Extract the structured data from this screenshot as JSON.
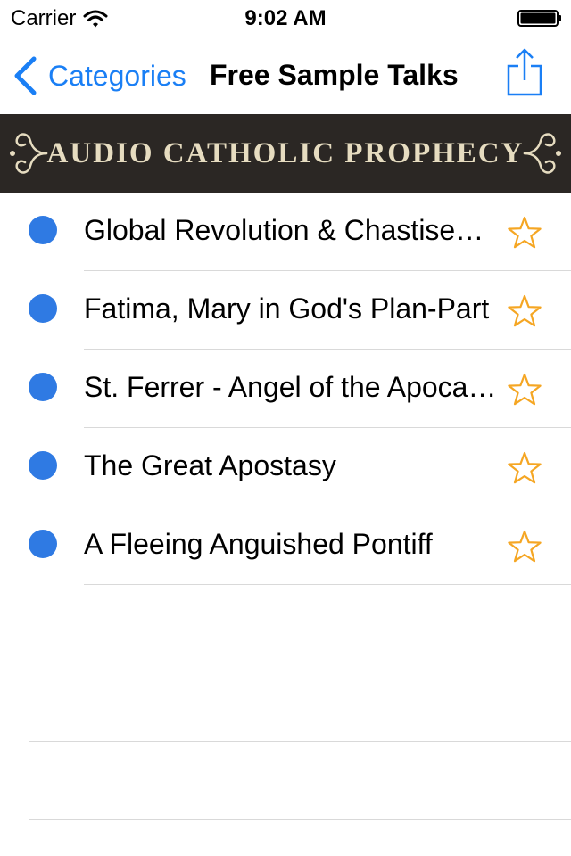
{
  "status_bar": {
    "carrier": "Carrier",
    "time": "9:02 AM"
  },
  "nav": {
    "back_label": "Categories",
    "title": "Free Sample Talks"
  },
  "banner": {
    "text": "Audio Catholic Prophecy"
  },
  "talks": [
    {
      "title": "Global Revolution & Chastisement"
    },
    {
      "title": "Fatima, Mary in God's Plan-Part"
    },
    {
      "title": "St. Ferrer - Angel of the Apocalypse"
    },
    {
      "title": "The Great Apostasy"
    },
    {
      "title": "A Fleeing Anguished Pontiff"
    }
  ],
  "colors": {
    "accent": "#1a7ff5",
    "dot": "#2f7ae3",
    "star": "#f5a623",
    "banner_bg": "#2b2724"
  },
  "icons": {
    "back": "chevron-left-icon",
    "share": "share-icon",
    "favorite": "star-outline-icon",
    "unplayed": "unplayed-dot-icon"
  }
}
